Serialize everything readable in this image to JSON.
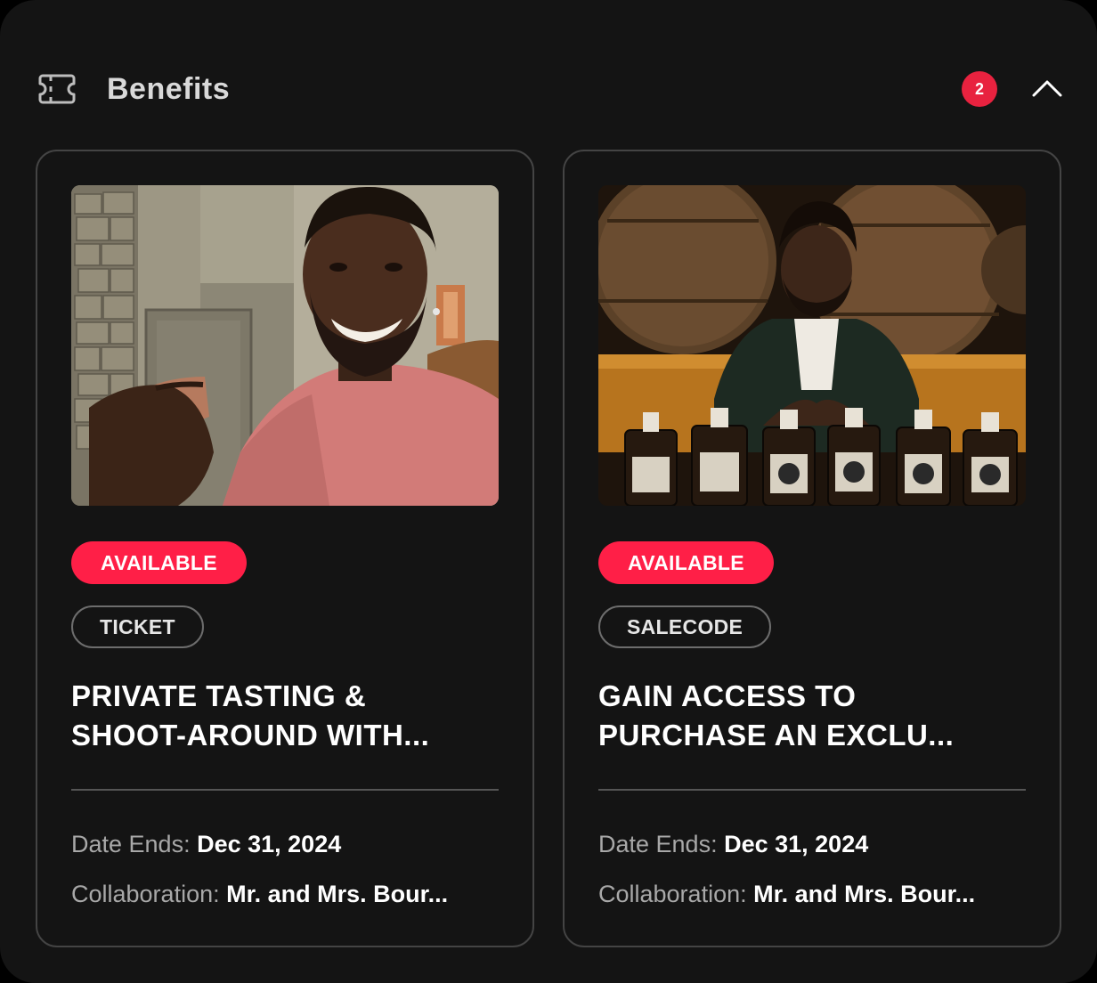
{
  "header": {
    "title": "Benefits",
    "count": "2",
    "icon": "ticket-icon",
    "collapse_icon": "chevron-up-icon"
  },
  "colors": {
    "panel_bg": "#141414",
    "accent": "#ff1f47",
    "badge": "#e8223f",
    "border": "#444444"
  },
  "cards": [
    {
      "status": "AVAILABLE",
      "type": "TICKET",
      "title_line1": "PRIVATE TASTING &",
      "title_line2": "SHOOT-AROUND WITH...",
      "date_label": "Date Ends:",
      "date_value": "Dec 31, 2024",
      "collab_label": "Collaboration:",
      "collab_value": "Mr. and Mrs. Bour..."
    },
    {
      "status": "AVAILABLE",
      "type": "SALECODE",
      "title_line1": "GAIN ACCESS TO",
      "title_line2": "PURCHASE AN EXCLU...",
      "date_label": "Date Ends:",
      "date_value": "Dec 31, 2024",
      "collab_label": "Collaboration:",
      "collab_value": "Mr. and Mrs. Bour..."
    }
  ]
}
